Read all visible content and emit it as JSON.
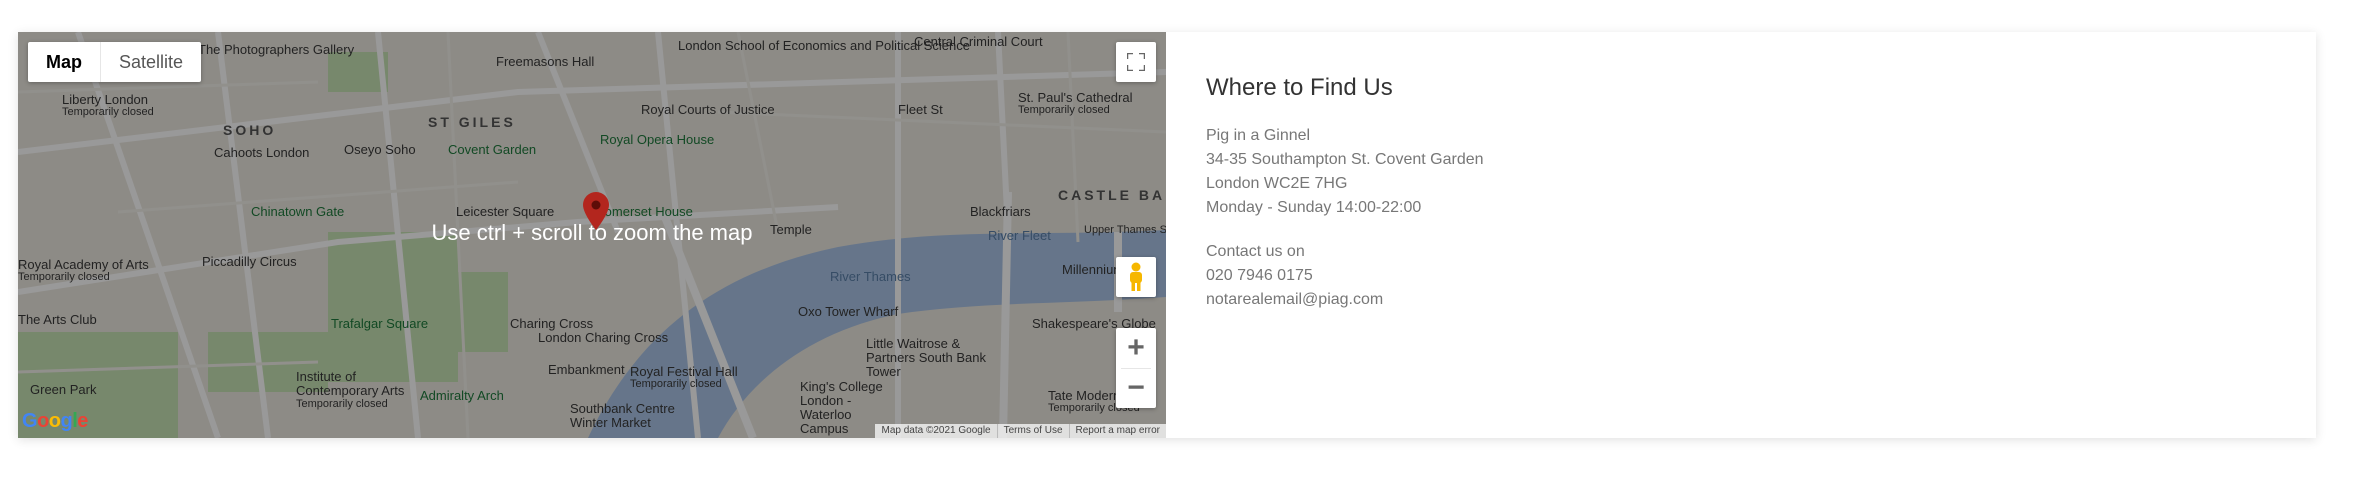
{
  "map": {
    "type_controls": {
      "map": "Map",
      "satellite": "Satellite"
    },
    "overlay_message": "Use ctrl + scroll to zoom the map",
    "google_logo": "Google",
    "attribution": {
      "data": "Map data ©2021 Google",
      "terms": "Terms of Use",
      "report": "Report a map error"
    },
    "zoom": {
      "in": "+",
      "out": "−"
    },
    "places": {
      "photographers_gallery": "The Photographers Gallery",
      "freemasons_hall": "Freemasons Hall",
      "lse": "London School of Economics and Political Science",
      "central_criminal_court": "Central Criminal Court",
      "liberty": "Liberty London",
      "liberty_status": "Temporarily closed",
      "soho": "SOHO",
      "st_giles": "ST GILES",
      "royal_courts": "Royal Courts of Justice",
      "fleet_st": "Fleet St",
      "st_pauls": "St. Paul's Cathedral",
      "st_pauls_status": "Temporarily closed",
      "cahoots": "Cahoots London",
      "oseyo": "Oseyo Soho",
      "covent_garden": "Covent Garden",
      "royal_opera_house": "Royal Opera House",
      "castle_baynard": "CASTLE BA",
      "chinatown_gate": "Chinatown Gate",
      "leicester_square": "Leicester Square",
      "somerset_house": "Somerset House",
      "temple": "Temple",
      "blackfriars": "Blackfriars",
      "river_fleet": "River Fleet",
      "upper_thames": "Upper Thames St",
      "royal_academy": "Royal Academy of Arts",
      "royal_academy_status": "Temporarily closed",
      "piccadilly_circus": "Piccadilly Circus",
      "river_thames": "River Thames",
      "millennium_bridge": "Millennium Bri",
      "arts_club": "The Arts Club",
      "trafalgar_square": "Trafalgar Square",
      "charing_cross": "Charing Cross",
      "london_charing_cross": "London Charing Cross",
      "oxo_tower": "Oxo Tower Wharf",
      "shakespeares_globe": "Shakespeare's Globe",
      "little_waitrose": "Little Waitrose & Partners South Bank Tower",
      "green_park": "Green Park",
      "ica": "Institute of Contemporary Arts",
      "ica_status": "Temporarily closed",
      "admiralty_arch": "Admiralty Arch",
      "embankment": "Embankment",
      "royal_festival_hall": "Royal Festival Hall",
      "royal_festival_status": "Temporarily closed",
      "southbank_centre": "Southbank Centre Winter Market",
      "kings_college": "King's College London - Waterloo Campus",
      "tate_modern": "Tate Modern",
      "tate_status": "Temporarily closed"
    }
  },
  "info": {
    "title": "Where to Find Us",
    "name": "Pig in a Ginnel",
    "address1": "34-35 Southampton St. Covent Garden",
    "address2": "London WC2E 7HG",
    "hours": "Monday - Sunday 14:00-22:00",
    "contact_label": "Contact us on",
    "phone": "020 7946 0175",
    "email": "notarealemail@piag.com"
  },
  "colors": {
    "water": "#aac4e6",
    "park": "#c6e3b4",
    "pin": "#d93025",
    "background": "#e9e5dc"
  }
}
